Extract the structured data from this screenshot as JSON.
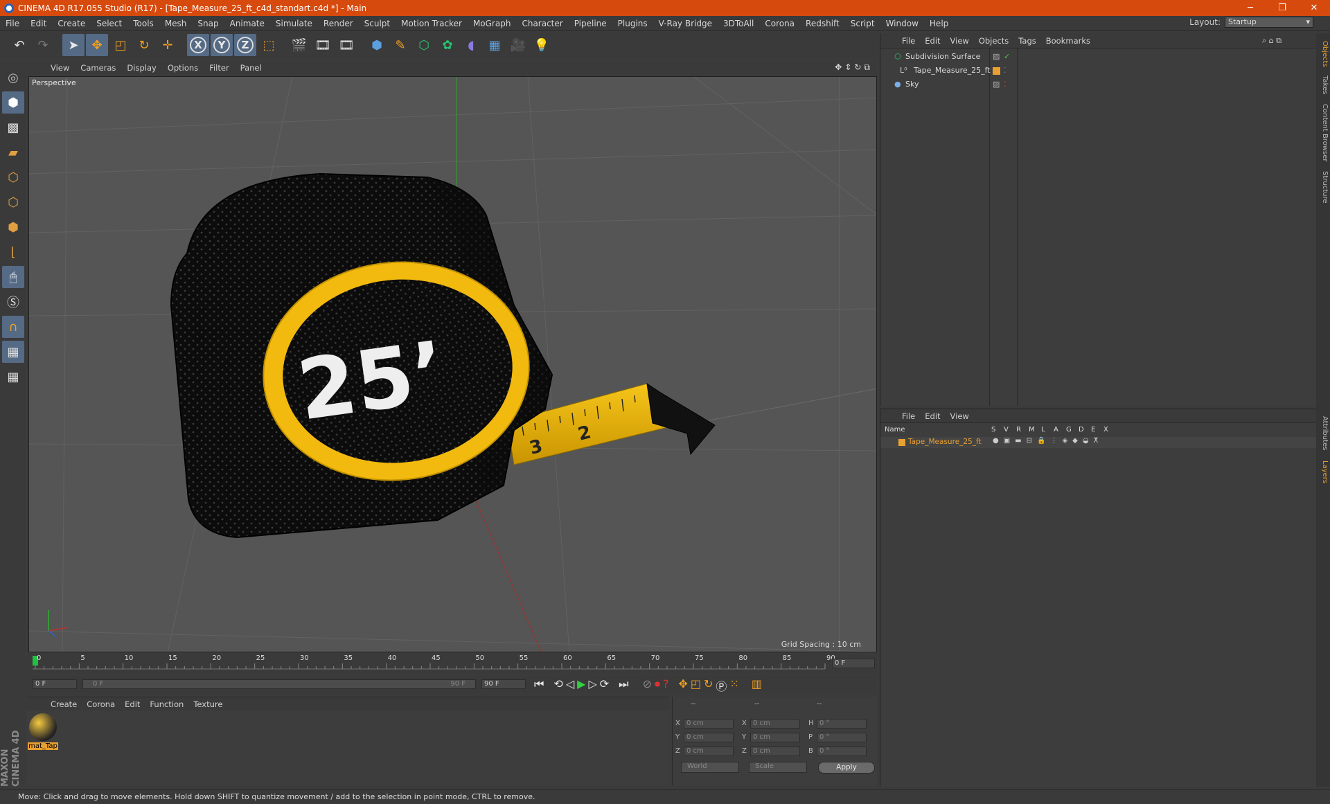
{
  "window": {
    "title": "CINEMA 4D R17.055 Studio (R17) - [Tape_Measure_25_ft_c4d_standart.c4d *] - Main",
    "minimize": "─",
    "maximize": "❐",
    "close": "✕"
  },
  "menu": [
    "File",
    "Edit",
    "Create",
    "Select",
    "Tools",
    "Mesh",
    "Snap",
    "Animate",
    "Simulate",
    "Render",
    "Sculpt",
    "Motion Tracker",
    "MoGraph",
    "Character",
    "Pipeline",
    "Plugins",
    "V-Ray Bridge",
    "3DToAll",
    "Corona",
    "Redshift",
    "Script",
    "Window",
    "Help"
  ],
  "layout": {
    "label": "Layout:",
    "value": "Startup"
  },
  "viewport": {
    "menu": [
      "View",
      "Cameras",
      "Display",
      "Options",
      "Filter",
      "Panel"
    ],
    "label": "Perspective",
    "grid_spacing": "Grid Spacing : 10 cm",
    "model_text": "25’"
  },
  "timeline": {
    "ticks": [
      "0",
      "5",
      "10",
      "15",
      "20",
      "25",
      "30",
      "35",
      "40",
      "45",
      "50",
      "55",
      "60",
      "65",
      "70",
      "75",
      "80",
      "85",
      "90"
    ],
    "current_frame": "0 F",
    "start": "0 F",
    "range_start": "0 F",
    "range_end": "90 F",
    "end": "90 F"
  },
  "material_manager": {
    "menu": [
      "Create",
      "Corona",
      "Edit",
      "Function",
      "Texture"
    ],
    "material_name": "mat_Tap"
  },
  "coordinates": {
    "header": [
      "--",
      "--",
      "--"
    ],
    "rows": [
      {
        "a": "X",
        "av": "0 cm",
        "b": "X",
        "bv": "0 cm",
        "c": "H",
        "cv": "0 °"
      },
      {
        "a": "Y",
        "av": "0 cm",
        "b": "Y",
        "bv": "0 cm",
        "c": "P",
        "cv": "0 °"
      },
      {
        "a": "Z",
        "av": "0 cm",
        "b": "Z",
        "bv": "0 cm",
        "c": "B",
        "cv": "0 °"
      }
    ],
    "mode1": "World",
    "mode2": "Scale",
    "apply": "Apply"
  },
  "object_manager": {
    "menu": [
      "File",
      "Edit",
      "View",
      "Objects",
      "Tags",
      "Bookmarks"
    ],
    "objects": [
      "Subdivision Surface",
      "Tape_Measure_25_ft",
      "Sky"
    ]
  },
  "layer_manager": {
    "menu": [
      "File",
      "Edit",
      "View"
    ],
    "columns": [
      "Name",
      "S",
      "V",
      "R",
      "M",
      "L",
      "A",
      "G",
      "D",
      "E",
      "X"
    ],
    "layer": "Tape_Measure_25_ft"
  },
  "side_tabs": [
    "Objects",
    "Takes",
    "Content Browser",
    "Structure",
    "Attributes",
    "Layers"
  ],
  "branding": "MAXON CINEMA 4D",
  "status": "Move: Click and drag to move elements. Hold down SHIFT to quantize movement / add to the selection in point mode, CTRL to remove.",
  "colors": {
    "titlebar": "#d64a0e",
    "accent": "#e8a030",
    "active_tool": "#556a85",
    "tape_yellow": "#f2b90f"
  }
}
